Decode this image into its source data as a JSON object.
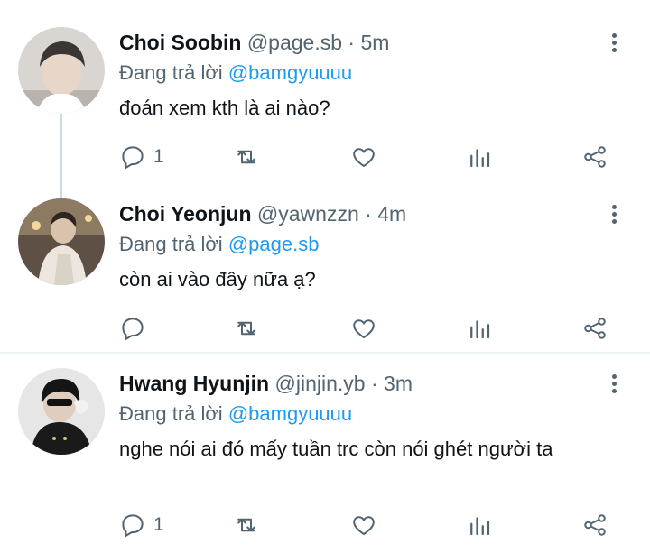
{
  "tweets": [
    {
      "name": "Choi Soobin",
      "handle": "@page.sb",
      "dot": "·",
      "time": "5m",
      "reply_prefix": "Đang trả lời",
      "reply_to": "@bamgyuuuu",
      "text": "đoán xem kth là ai nào?",
      "reply_count": "1"
    },
    {
      "name": "Choi Yeonjun",
      "handle": "@yawnzzn",
      "dot": "·",
      "time": "4m",
      "reply_prefix": "Đang trả lời",
      "reply_to": "@page.sb",
      "text": "còn ai vào đây nữa ạ?",
      "reply_count": ""
    },
    {
      "name": "Hwang Hyunjin",
      "handle": "@jinjin.yb",
      "dot": "·",
      "time": "3m",
      "reply_prefix": "Đang trả lời",
      "reply_to": "@bamgyuuuu",
      "text": "nghe nói ai đó mấy tuần trc còn nói ghét người ta",
      "reply_count": "1"
    }
  ],
  "icons": {
    "reply": "reply-icon",
    "retweet": "retweet-icon",
    "like": "like-icon",
    "views": "views-icon",
    "share": "share-icon",
    "more": "more-options-icon"
  },
  "colors": {
    "text": "#0f1419",
    "secondary": "#536471",
    "link": "#1d9bf0",
    "thread_line": "#cfd9de",
    "divider": "#eff3f4"
  }
}
